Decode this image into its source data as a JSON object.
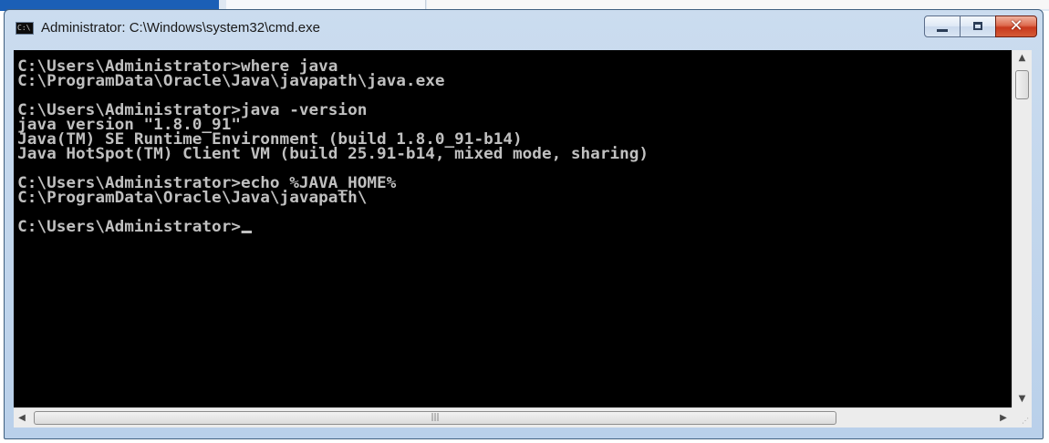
{
  "window": {
    "title": "Administrator: C:\\Windows\\system32\\cmd.exe",
    "icon": "cmd-icon"
  },
  "console": {
    "lines": [
      "C:\\Users\\Administrator>where java",
      "C:\\ProgramData\\Oracle\\Java\\javapath\\java.exe",
      "",
      "C:\\Users\\Administrator>java -version",
      "java version \"1.8.0_91\"",
      "Java(TM) SE Runtime Environment (build 1.8.0_91-b14)",
      "Java HotSpot(TM) Client VM (build 25.91-b14, mixed mode, sharing)",
      "",
      "C:\\Users\\Administrator>echo %JAVA_HOME%",
      "C:\\ProgramData\\Oracle\\Java\\javapath\\",
      "",
      "C:\\Users\\Administrator>"
    ]
  },
  "colors": {
    "console_bg": "#000000",
    "console_text": "#c0c0c0",
    "close_button": "#c8391d"
  }
}
